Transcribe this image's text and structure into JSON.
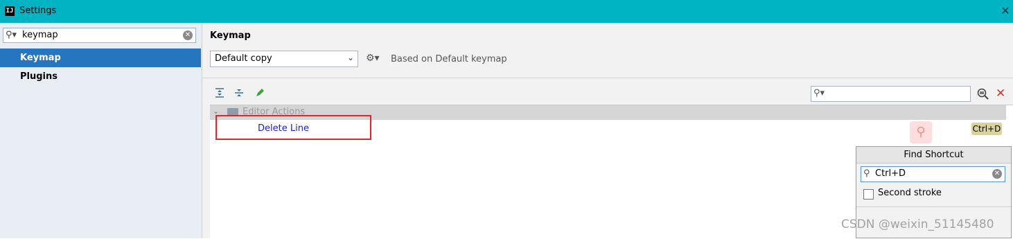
{
  "window": {
    "icon_text": "IJ",
    "title": "Settings",
    "close_icon": "close-icon"
  },
  "sidebar": {
    "search": {
      "value": "keymap",
      "clear_icon": "clear-search-icon"
    },
    "items": [
      {
        "label": "Keymap",
        "selected": true
      },
      {
        "label": "Plugins",
        "selected": false
      }
    ]
  },
  "main": {
    "title": "Keymap",
    "keymap_select": {
      "selected": "Default copy"
    },
    "based_on": "Based on Default keymap",
    "toolbar": {
      "icons": [
        "expand-all-icon",
        "collapse-all-icon",
        "edit-icon"
      ],
      "filter_placeholder": "",
      "find_icon": "find-shortcut-icon",
      "remove_icon": "clear-filter-icon"
    },
    "tree": {
      "group_label": "Editor Actions",
      "action_label": "Delete Line",
      "shortcut": "Ctrl+D"
    }
  },
  "find_shortcut_popup": {
    "title": "Find Shortcut",
    "value": "Ctrl+D",
    "second_stroke_label": "Second stroke",
    "second_stroke_checked": false
  },
  "watermark": "CSDN @weixin_51145480",
  "colors": {
    "titlebar": "#00b4c4",
    "selection": "#2675bf",
    "highlight_border": "#e8202a",
    "shortcut_badge": "#d9d29b",
    "action_text": "#1c1ccc"
  }
}
